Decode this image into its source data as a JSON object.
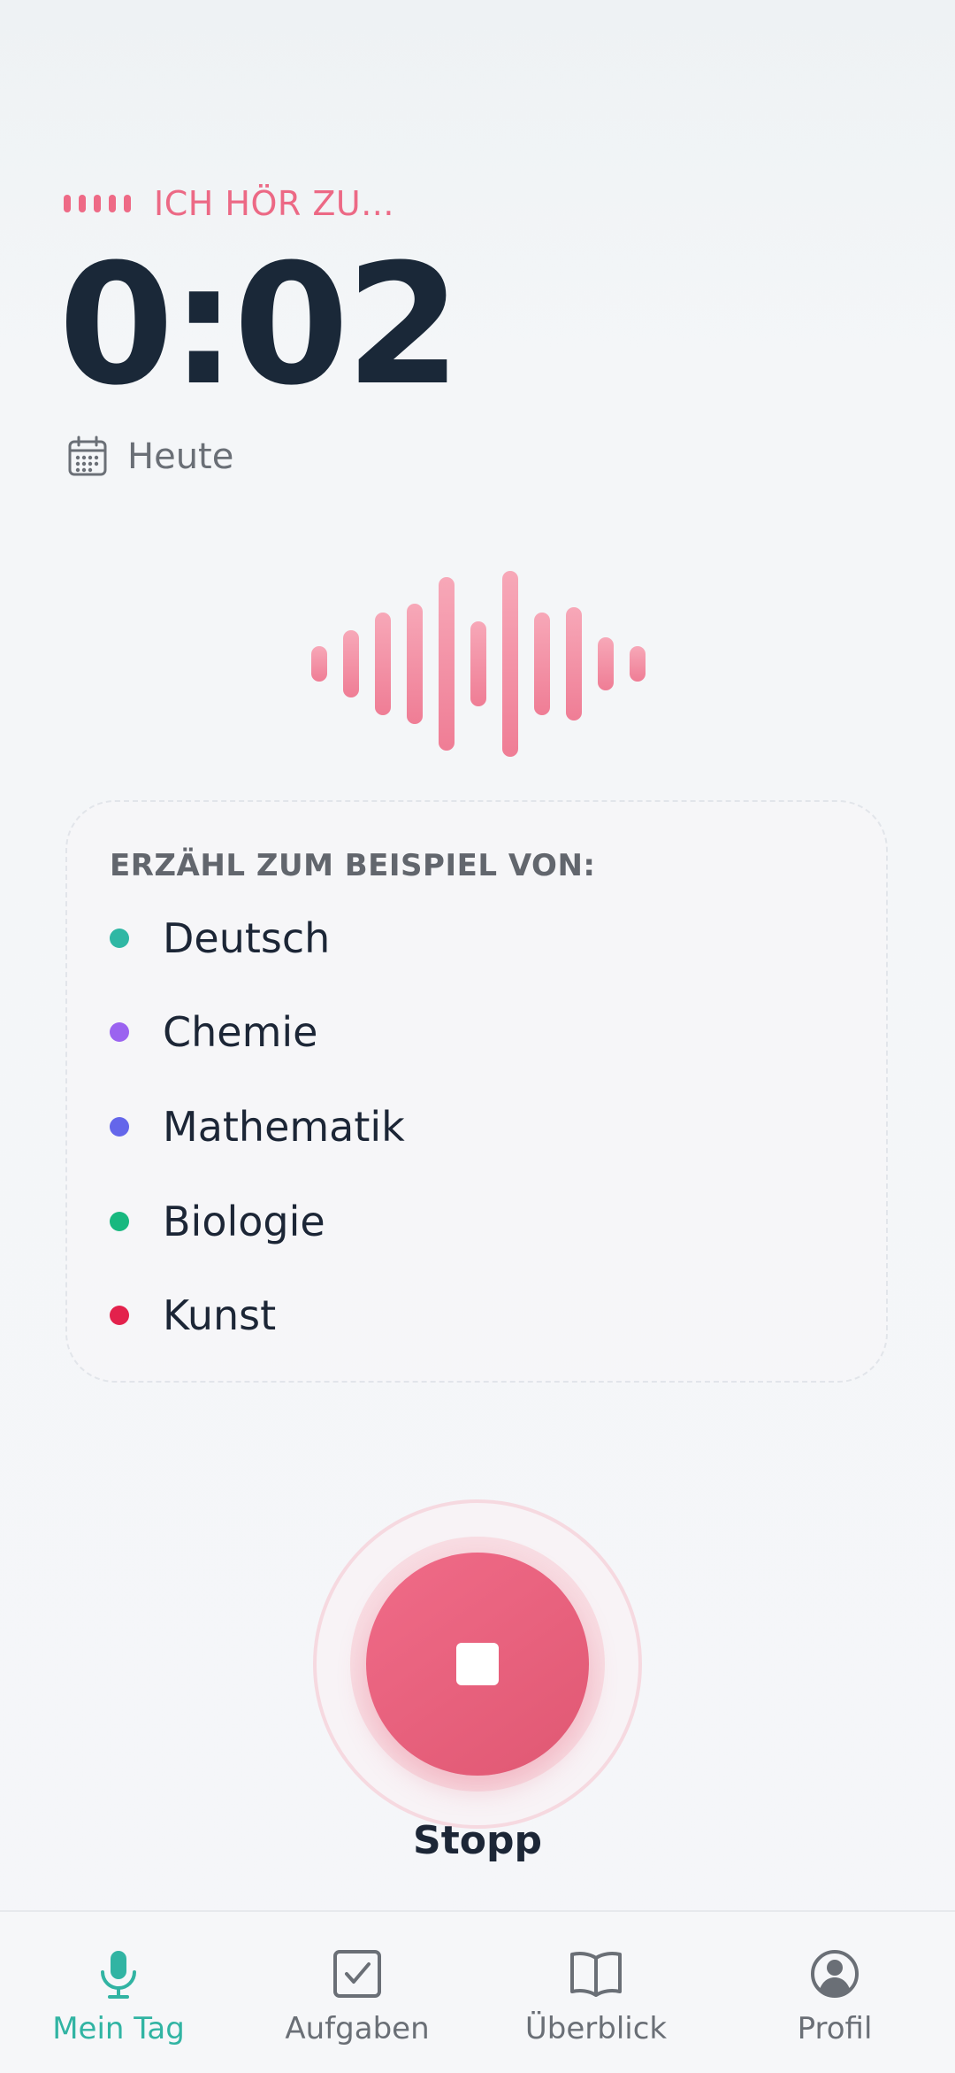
{
  "status": {
    "listening_label": "ICH HÖR ZU...",
    "timer": "0:02",
    "date_label": "Heute"
  },
  "suggestions": {
    "title": "ERZÄHL ZUM BEISPIEL VON:",
    "items": [
      {
        "label": "Deutsch",
        "color": "#2fb7a4"
      },
      {
        "label": "Chemie",
        "color": "#9b63f0"
      },
      {
        "label": "Mathematik",
        "color": "#6466ea"
      },
      {
        "label": "Biologie",
        "color": "#18b87f"
      },
      {
        "label": "Kunst",
        "color": "#e3214c"
      }
    ]
  },
  "stop_button": {
    "label": "Stopp"
  },
  "nav": {
    "items": [
      {
        "label": "Mein Tag",
        "icon": "microphone-icon",
        "active": true
      },
      {
        "label": "Aufgaben",
        "icon": "checkbox-icon",
        "active": false
      },
      {
        "label": "Überblick",
        "icon": "book-icon",
        "active": false
      },
      {
        "label": "Profil",
        "icon": "user-circle-icon",
        "active": false
      }
    ]
  },
  "colors": {
    "accent_pink": "#ec6985",
    "accent_teal": "#31b4a3",
    "text_dark": "#1a2838",
    "text_muted": "#6a6f76"
  }
}
